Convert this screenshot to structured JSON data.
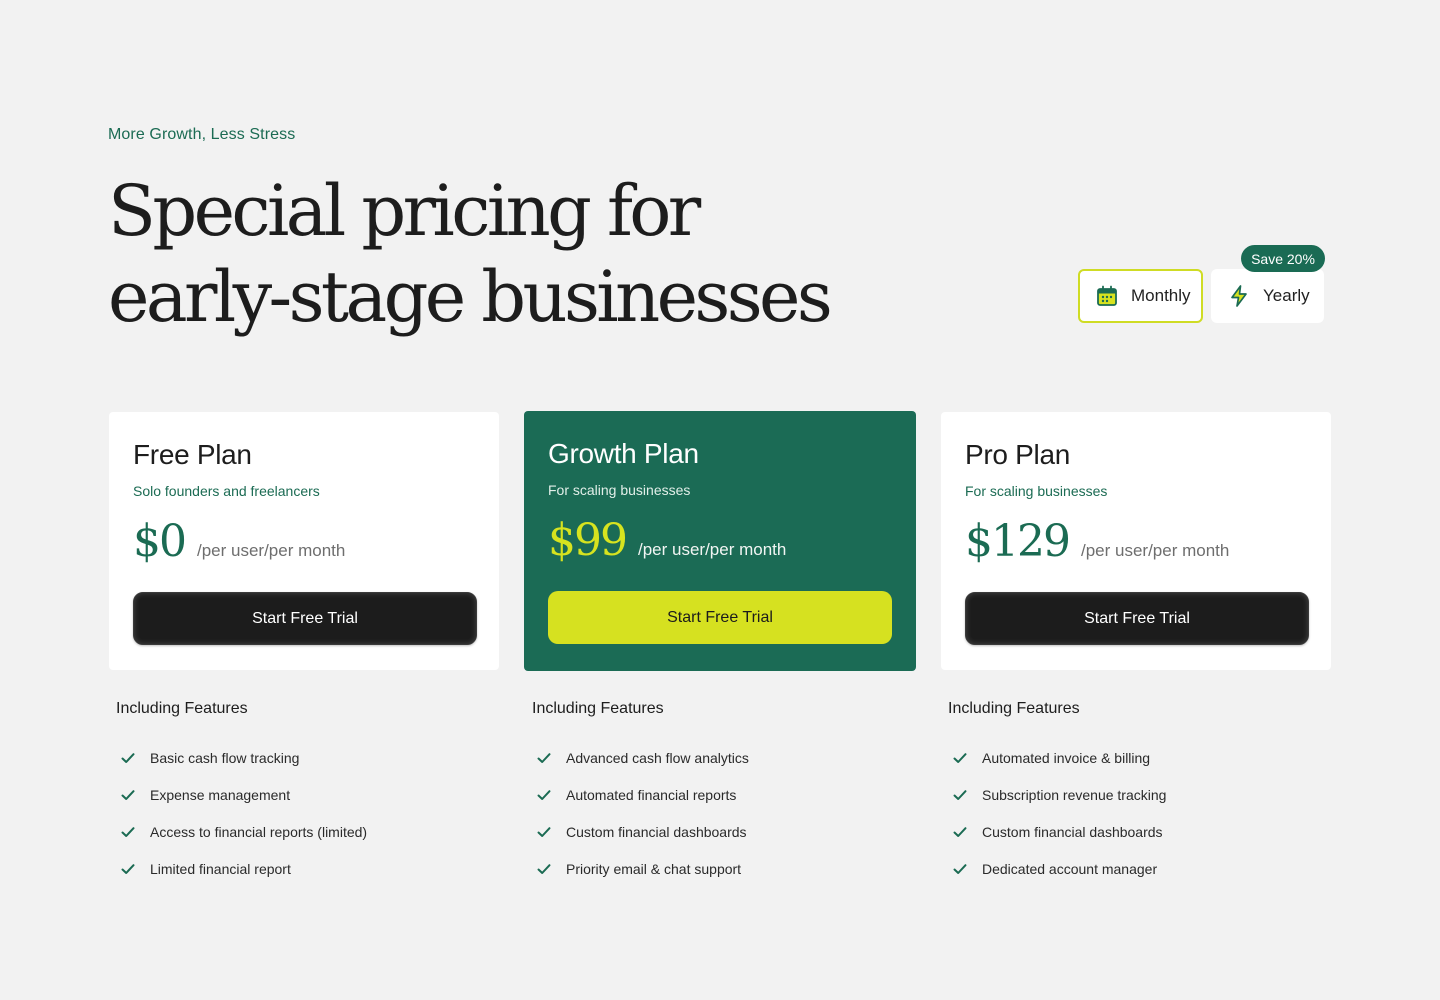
{
  "header": {
    "eyebrow": "More Growth, Less Stress",
    "headline_line1": "Special pricing for",
    "headline_line2": "early-stage businesses"
  },
  "billing_toggle": {
    "monthly_label": "Monthly",
    "yearly_label": "Yearly",
    "save_badge": "Save 20%",
    "selected": "Monthly",
    "monthly_icon": "calendar-icon",
    "yearly_icon": "lightning-icon"
  },
  "colors": {
    "brand_green": "#1b6b55",
    "accent_lime": "#d6e120",
    "background": "#f2f2f2",
    "button_dark": "#1c1c1c"
  },
  "plans": [
    {
      "name": "Free Plan",
      "subtitle": "Solo founders and freelancers",
      "price": "$0",
      "period": "/per user/per month",
      "cta": "Start Free Trial",
      "features_title": "Including Features",
      "features": [
        "Basic cash flow tracking",
        "Expense management",
        "Access to financial reports (limited)",
        "Limited financial report"
      ]
    },
    {
      "name": "Growth Plan",
      "subtitle": "For scaling businesses",
      "price": "$99",
      "period": "/per user/per month",
      "cta": "Start Free Trial",
      "features_title": "Including Features",
      "features": [
        "Advanced cash flow analytics",
        "Automated financial reports",
        "Custom financial dashboards",
        "Priority email & chat support"
      ]
    },
    {
      "name": "Pro Plan",
      "subtitle": "For scaling businesses",
      "price": "$129",
      "period": "/per user/per month",
      "cta": "Start Free Trial",
      "features_title": "Including Features",
      "features": [
        "Automated invoice & billing",
        "Subscription revenue tracking",
        "Custom financial dashboards",
        "Dedicated account manager"
      ]
    }
  ]
}
